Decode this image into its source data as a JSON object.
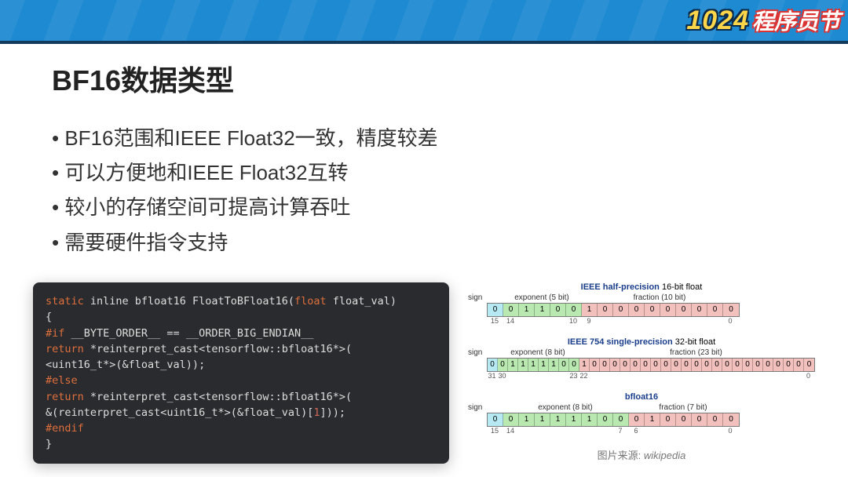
{
  "logo": {
    "number": "1024",
    "text": "程序员节"
  },
  "title": "BF16数据类型",
  "bullets": [
    "BF16范围和IEEE Float32一致，精度较差",
    "可以方便地和IEEE Float32互转",
    "较小的存储空间可提高计算吞吐",
    "需要硬件指令支持"
  ],
  "code": {
    "line1a": "static",
    "line1b": " inline bfloat16 FloatToBFloat16(",
    "line1c": "float",
    "line1d": " float_val)",
    "line2": "{",
    "line3a": "#if",
    "line3b": " __BYTE_ORDER__ == __ORDER_BIG_ENDIAN__",
    "line4a": "return",
    "line4b": " *reinterpret_cast<tensorflow::bfloat16*>(",
    "line5": "<uint16_t*>(&float_val));",
    "line6": "#else",
    "line7a": "return",
    "line7b": " *reinterpret_cast<tensorflow::bfloat16*>(",
    "line8a": "&(reinterpret_cast<uint16_t*>(&float_val)[",
    "line8b": "1",
    "line8c": "]));",
    "line9": "#endif",
    "line10": "}"
  },
  "diagrams": {
    "signLabel": "sign",
    "half": {
      "titlePrefix": "IEEE half-precision",
      "titleRest": " 16-bit float",
      "expLabel": "exponent (5 bit)",
      "fracLabel": "fraction (10 bit)",
      "bits": [
        "0",
        "0",
        "1",
        "1",
        "0",
        "0",
        "1",
        "0",
        "0",
        "0",
        "0",
        "0",
        "0",
        "0",
        "0",
        "0"
      ],
      "expCount": 5,
      "fracCount": 10,
      "idx": [
        "15",
        "14",
        "10",
        "9",
        "0"
      ]
    },
    "f32": {
      "titlePrefix": "IEEE 754 single-precision",
      "titleRest": " 32-bit float",
      "expLabel": "exponent (8 bit)",
      "fracLabel": "fraction (23 bit)",
      "bits": [
        "0",
        "0",
        "1",
        "1",
        "1",
        "1",
        "1",
        "0",
        "0",
        "1",
        "0",
        "0",
        "0",
        "0",
        "0",
        "0",
        "0",
        "0",
        "0",
        "0",
        "0",
        "0",
        "0",
        "0",
        "0",
        "0",
        "0",
        "0",
        "0",
        "0",
        "0",
        "0"
      ],
      "expCount": 8,
      "fracCount": 23,
      "idx": [
        "31",
        "30",
        "23",
        "22",
        "0"
      ]
    },
    "bf16": {
      "titlePlain": "bfloat16",
      "expLabel": "exponent (8 bit)",
      "fracLabel": "fraction (7 bit)",
      "bits": [
        "0",
        "0",
        "1",
        "1",
        "1",
        "1",
        "1",
        "0",
        "0",
        "0",
        "1",
        "0",
        "0",
        "0",
        "0",
        "0"
      ],
      "expCount": 8,
      "fracCount": 7,
      "idx": [
        "15",
        "14",
        "7",
        "6",
        "0"
      ]
    }
  },
  "caption": {
    "pre": "图片来源: ",
    "src": "wikipedia"
  }
}
